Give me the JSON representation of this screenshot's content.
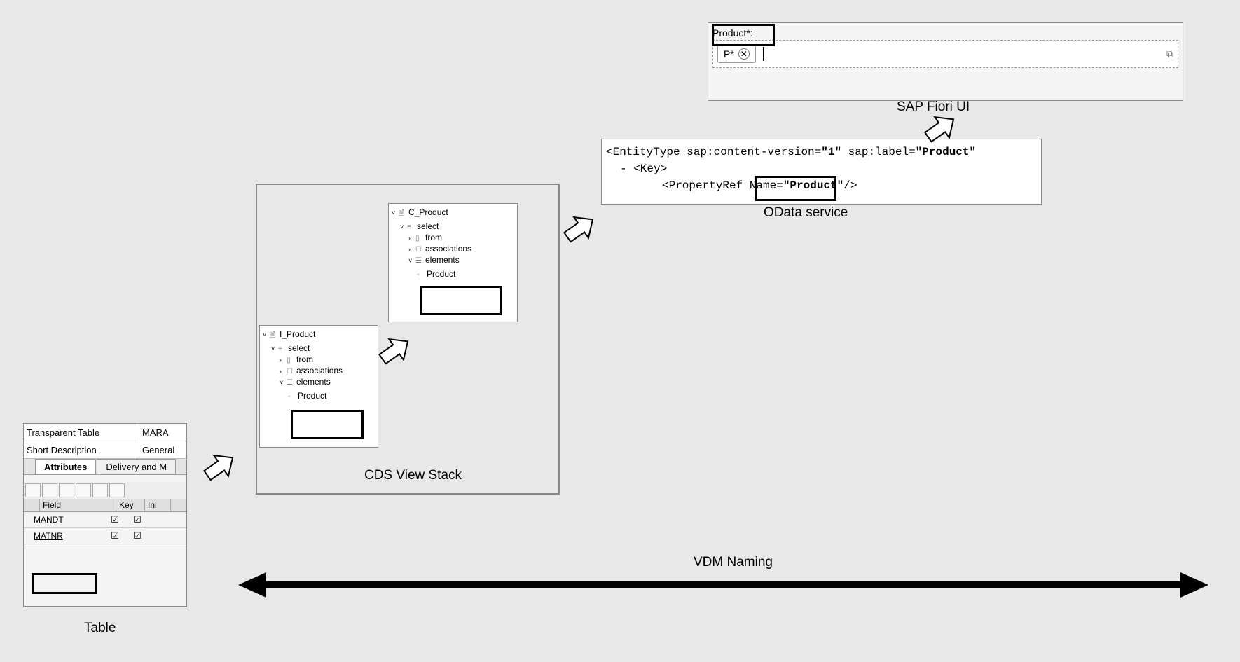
{
  "table": {
    "type_label": "Transparent Table",
    "type_value": "MARA",
    "desc_label": "Short Description",
    "desc_value": "General",
    "tab_attributes": "Attributes",
    "tab_delivery": "Delivery and M",
    "col_field": "Field",
    "col_key": "Key",
    "col_ini": "Ini",
    "fields": [
      {
        "name": "MANDT",
        "key": true,
        "ini": true
      },
      {
        "name": "MATNR",
        "key": true,
        "ini": true
      }
    ],
    "caption": "Table"
  },
  "cds": {
    "caption": "CDS View Stack",
    "i_product": {
      "name": "I_Product",
      "select": "select",
      "from": "from",
      "associations": "associations",
      "elements": "elements",
      "product": "Product"
    },
    "c_product": {
      "name": "C_Product",
      "select": "select",
      "from": "from",
      "associations": "associations",
      "elements": "elements",
      "product": "Product"
    }
  },
  "odata": {
    "line1_prefix": "<EntityType sap:content-version=",
    "line1_version": "\"1\"",
    "line1_mid": " sap:label=",
    "line1_label": "\"Product\"",
    "line2": "-  <Key>",
    "line3_prefix": "<PropertyRef Name=",
    "line3_value": "\"Product\"",
    "line3_suffix": "/>",
    "caption": "OData service"
  },
  "fiori": {
    "label": "Product*:",
    "token": "P*",
    "caption": "SAP Fiori UI"
  },
  "vdm_label": "VDM Naming"
}
